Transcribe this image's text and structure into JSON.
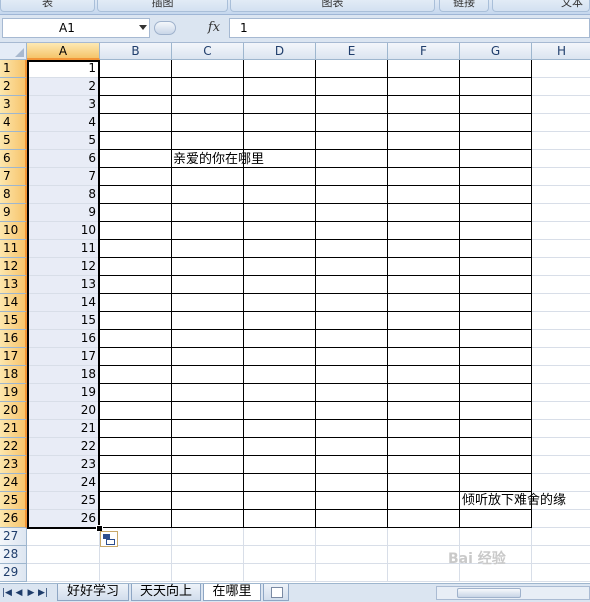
{
  "ribbon": {
    "groups": [
      "表",
      "插图",
      "图表",
      "链接",
      "文本"
    ]
  },
  "formula_bar": {
    "name_box": "A1",
    "fx_label": "fx",
    "value": "1"
  },
  "sheet": {
    "columns": [
      "A",
      "B",
      "C",
      "D",
      "E",
      "F",
      "G",
      "H"
    ],
    "rows": [
      "1",
      "2",
      "3",
      "4",
      "5",
      "6",
      "7",
      "8",
      "9",
      "10",
      "11",
      "12",
      "13",
      "14",
      "15",
      "16",
      "17",
      "18",
      "19",
      "20",
      "21",
      "22",
      "23",
      "24",
      "25",
      "26",
      "27",
      "28",
      "29"
    ],
    "column_a_values": [
      "1",
      "2",
      "3",
      "4",
      "5",
      "6",
      "7",
      "8",
      "9",
      "10",
      "11",
      "12",
      "13",
      "14",
      "15",
      "16",
      "17",
      "18",
      "19",
      "20",
      "21",
      "22",
      "23",
      "24",
      "25",
      "26"
    ],
    "c6_text": "亲爱的你在哪里",
    "g25_text": "倾听放下难舍的缘"
  },
  "tabs": {
    "items": [
      "好好学习",
      "天天向上",
      "在哪里"
    ],
    "active": "在哪里"
  },
  "watermark": "Bai 经验",
  "colors": {
    "selection_header": "#f7c46c",
    "grid_border": "#000000",
    "accent_blue": "#1f3d6b"
  }
}
